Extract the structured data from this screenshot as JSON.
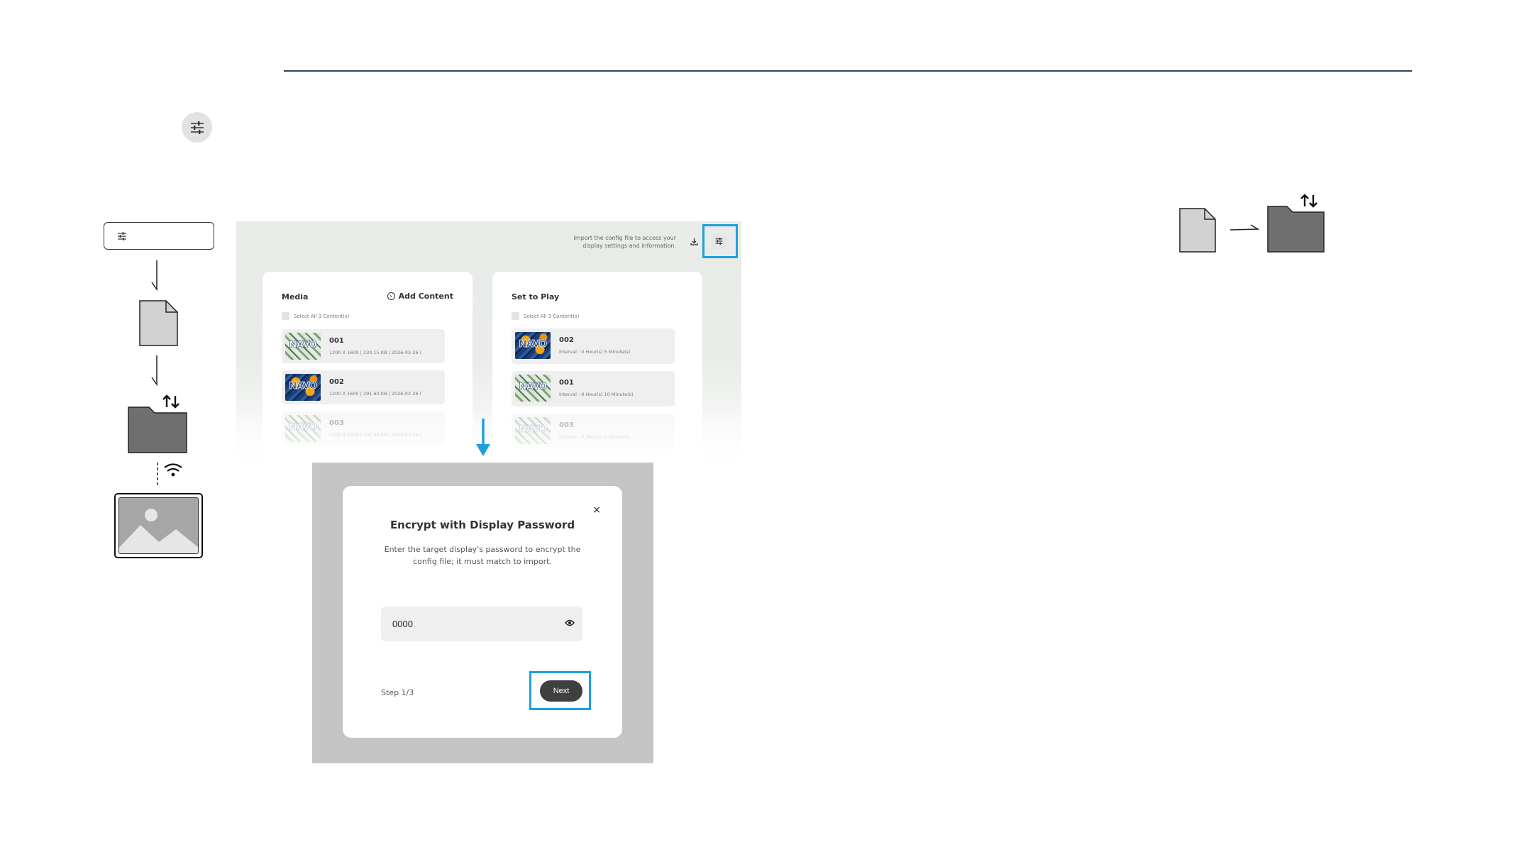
{
  "screenshot": {
    "import_hint": "Import the config file to access your display settings and information.",
    "media_card": {
      "title": "Media",
      "add_label": "Add Content",
      "select_all": "Select All 3 Content(s)",
      "items": [
        {
          "name": "001",
          "meta": "1200 X 1600  |  230.15 KB  |  2026-03-26 (",
          "thumb": "leaf"
        },
        {
          "name": "002",
          "meta": "1200 X 1600  |  291.60 KB  |  2026-03-26 (",
          "thumb": "orange"
        },
        {
          "name": "003",
          "meta": "1200 X 1600  |  202.89 KB  |  2026-03-26 (",
          "thumb": "leaf"
        }
      ]
    },
    "play_card": {
      "title": "Set to Play",
      "select_all": "Select All 3 Content(s)",
      "items": [
        {
          "name": "002",
          "meta": "Interval : 0 Hour(s) 5 Minute(s)",
          "thumb": "orange"
        },
        {
          "name": "001",
          "meta": "Interval : 0 Hour(s) 10 Minute(s)",
          "thumb": "leaf"
        },
        {
          "name": "003",
          "meta": "Interval : 0 Hour(s) 8 Minute(s)",
          "thumb": "leaf"
        }
      ]
    },
    "thumb_logo": "NAVO"
  },
  "modal": {
    "title": "Encrypt with Display Password",
    "description": "Enter the target display's password to encrypt the config file; it must match to import.",
    "password_value": "0000",
    "close_glyph": "×",
    "step_label": "Step 1/3",
    "next_label": "Next"
  },
  "colors": {
    "highlight": "#1ea0dc",
    "rule": "#244a6b",
    "button_dark": "#3f3f3f"
  }
}
